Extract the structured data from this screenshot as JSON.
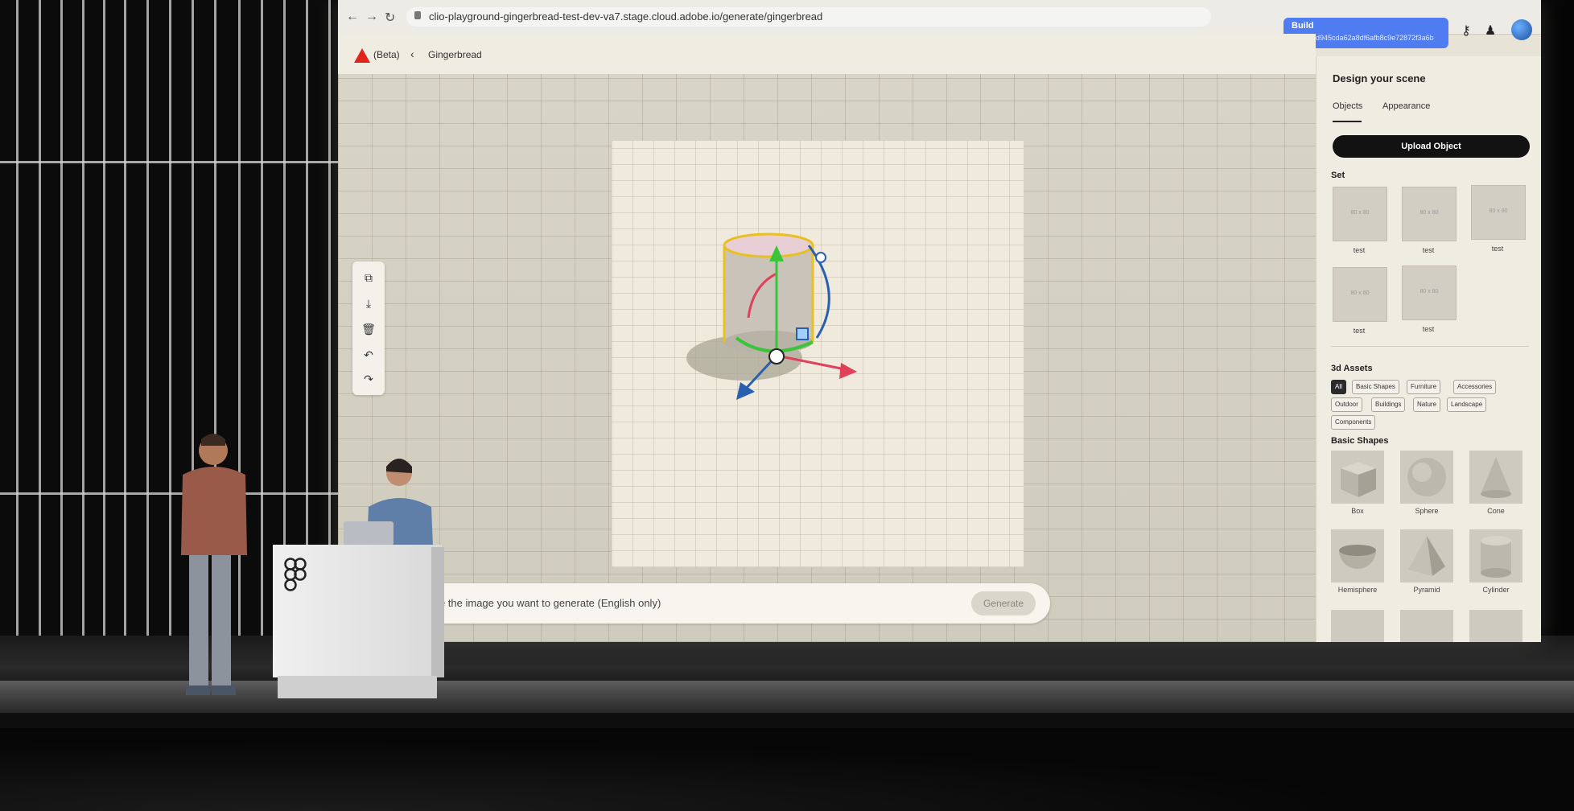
{
  "browser": {
    "url": "clio-playground-gingerbread-test-dev-va7.stage.cloud.adobe.io/generate/gingerbread",
    "build_label": "Build",
    "build_hash": "b6d984d945cda62a8df6afb8c9e72872f3a6b"
  },
  "app": {
    "beta_label": "(Beta)",
    "breadcrumb": "Gingerbread"
  },
  "prompt": {
    "placeholder": "cribe the image you want to generate (English only)",
    "generate_label": "Generate"
  },
  "panel": {
    "title": "Design your scene",
    "tabs": [
      "Objects",
      "Appearance"
    ],
    "upload_label": "Upload Object",
    "set_heading": "Set",
    "set_items": [
      {
        "thumb": "80 x 80",
        "label": "test"
      },
      {
        "thumb": "80 x 80",
        "label": "test"
      },
      {
        "thumb": "80 x 80",
        "label": "test"
      },
      {
        "thumb": "80 x 80",
        "label": "test"
      },
      {
        "thumb": "80 x 80",
        "label": "test"
      }
    ],
    "assets_heading": "3d Assets",
    "filters": [
      "All",
      "Basic Shapes",
      "Furniture",
      "Accessories",
      "Outdoor",
      "Buildings",
      "Nature",
      "Landscape",
      "Components"
    ],
    "active_filter": "All",
    "basic_heading": "Basic Shapes",
    "shapes": [
      "Box",
      "Sphere",
      "Cone",
      "Hemisphere",
      "Pyramid",
      "Cylinder"
    ]
  },
  "colors": {
    "accent_blue": "#4f7cf0",
    "adobe_red": "#e0241c",
    "gizmo_green": "#3ac43a",
    "gizmo_red": "#e0405a",
    "gizmo_blue": "#2a5fb0",
    "selection_yellow": "#e8c020"
  }
}
